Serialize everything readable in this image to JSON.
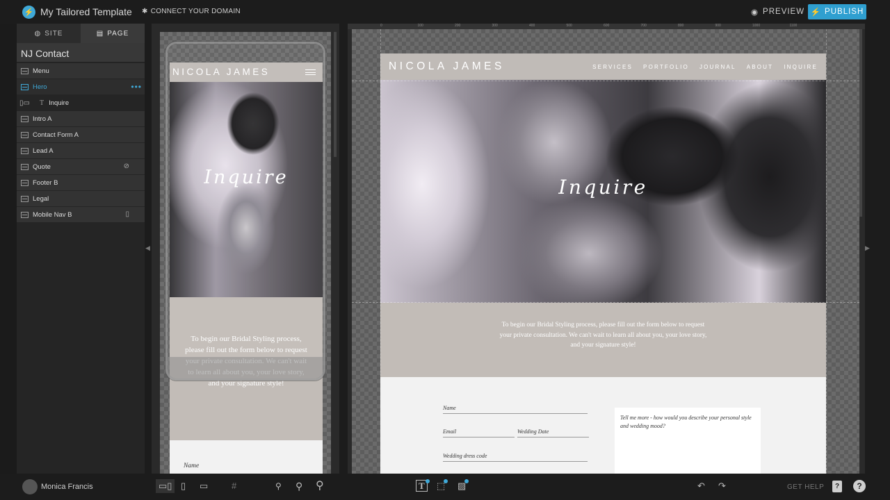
{
  "app": {
    "title": "My Tailored Template",
    "connect_domain": "CONNECT YOUR DOMAIN",
    "preview": "PREVIEW",
    "publish": "PUBLISH",
    "accent_color": "#2f9fd0"
  },
  "left_panel": {
    "tabs": [
      {
        "label": "SITE",
        "icon": "globe-icon"
      },
      {
        "label": "PAGE",
        "icon": "page-icon"
      }
    ],
    "page_name": "NJ Contact",
    "layers": [
      {
        "label": "Menu"
      },
      {
        "label": "Hero"
      },
      {
        "label": "Inquire"
      },
      {
        "label": "Intro A"
      },
      {
        "label": "Contact Form A"
      },
      {
        "label": "Lead A"
      },
      {
        "label": "Quote"
      },
      {
        "label": "Footer B"
      },
      {
        "label": "Legal"
      },
      {
        "label": "Mobile Nav B"
      }
    ],
    "hero_menu_glyph": "•••"
  },
  "site": {
    "brand": "NICOLA JAMES",
    "nav": [
      "SERVICES",
      "PORTFOLIO",
      "JOURNAL",
      "ABOUT",
      "INQUIRE"
    ],
    "hero_title": "Inquire",
    "intro_text": "To begin our Bridal Styling process, please fill out the form below to request your private consultation. We can't wait to learn all about you, your love story, and your signature style!",
    "form": {
      "name": "Name",
      "email": "Email",
      "wedding_date": "Wedding Date",
      "dress_code": "Wedding dress code",
      "message": "Tell me more - how would you describe your personal style and wedding mood?"
    }
  },
  "ruler": {
    "ticks": [
      "0",
      "100",
      "200",
      "300",
      "400",
      "500",
      "600",
      "700",
      "800",
      "900",
      "1000",
      "1100"
    ]
  },
  "bottom": {
    "user": "Monica Francis",
    "get_help": "GET HELP"
  }
}
